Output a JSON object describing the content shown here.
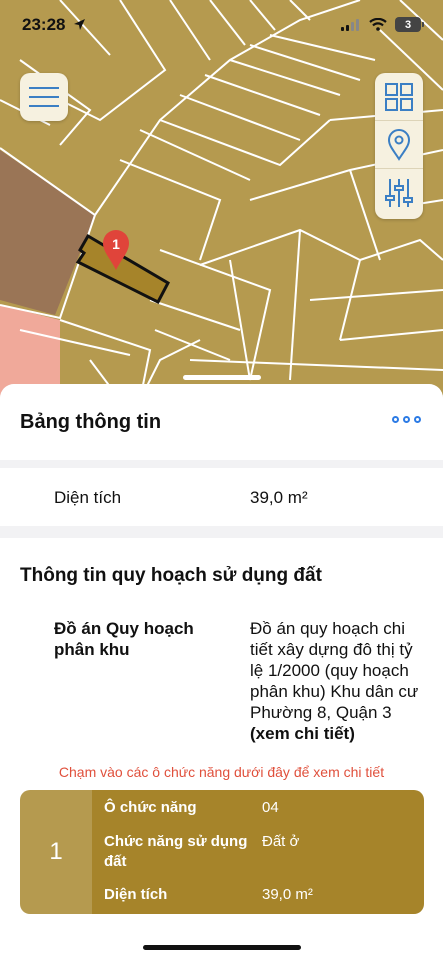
{
  "status_bar": {
    "time": "23:28",
    "battery": "3"
  },
  "map": {
    "marker_label": "1",
    "colors": {
      "land": "#b59a4f",
      "parcel_lines": "#ffffff",
      "brown_zone": "#9a7556",
      "pink_zone": "#f0a99a",
      "marker": "#e0443a"
    }
  },
  "map_controls": {
    "menu_icon": "hamburger-icon",
    "tools": [
      "grid-icon",
      "location-pin-icon",
      "sliders-icon"
    ]
  },
  "info_sheet": {
    "title": "Bảng thông tin",
    "area_label": "Diện tích",
    "area_value": "39,0 m²"
  },
  "planning": {
    "heading": "Thông tin quy hoạch sử dụng đất",
    "plan_label": "Đồ án Quy hoạch phân khu",
    "plan_value": "Đồ án quy hoạch chi tiết xây dựng đô thị tỷ lệ 1/2000 (quy hoạch phân khu) Khu dân cư Phường 8, Quận 3",
    "plan_link": "(xem chi tiết)",
    "hint": "Chạm vào các ô chức năng dưới đây để xem chi tiết"
  },
  "function_cell": {
    "number": "1",
    "rows": [
      {
        "key": "Ô chức năng",
        "value": "04"
      },
      {
        "key": "Chức năng sử dụng đất",
        "value": "Đất ở"
      },
      {
        "key": "Diện tích",
        "value": "39,0 m²"
      }
    ]
  }
}
